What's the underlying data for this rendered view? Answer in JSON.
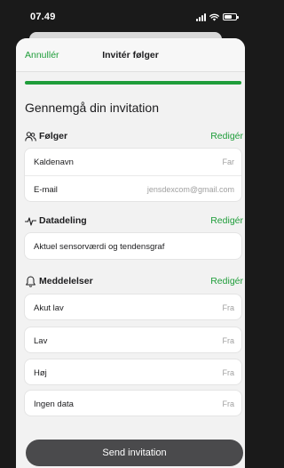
{
  "status_bar": {
    "time": "07.49"
  },
  "nav": {
    "cancel": "Annullér",
    "title": "Invitér følger"
  },
  "progress": {
    "fraction": 1.0
  },
  "heading": "Gennemgå din invitation",
  "follower": {
    "title": "Følger",
    "edit": "Redigér",
    "rows": [
      {
        "label": "Kaldenavn",
        "value": "Far"
      },
      {
        "label": "E-mail",
        "value": "jensdexcom@gmail.com"
      }
    ]
  },
  "data_sharing": {
    "title": "Datadeling",
    "edit": "Redigér",
    "value": "Aktuel sensorværdi og tendensgraf"
  },
  "notifications": {
    "title": "Meddelelser",
    "edit": "Redigér",
    "items": [
      {
        "label": "Akut lav",
        "value": "Fra"
      },
      {
        "label": "Lav",
        "value": "Fra"
      },
      {
        "label": "Høj",
        "value": "Fra"
      },
      {
        "label": "Ingen data",
        "value": "Fra"
      }
    ]
  },
  "send_button": "Send invitation",
  "colors": {
    "accent": "#1f9d3a",
    "button": "#4a4a4c",
    "background": "#f2f2f2"
  }
}
